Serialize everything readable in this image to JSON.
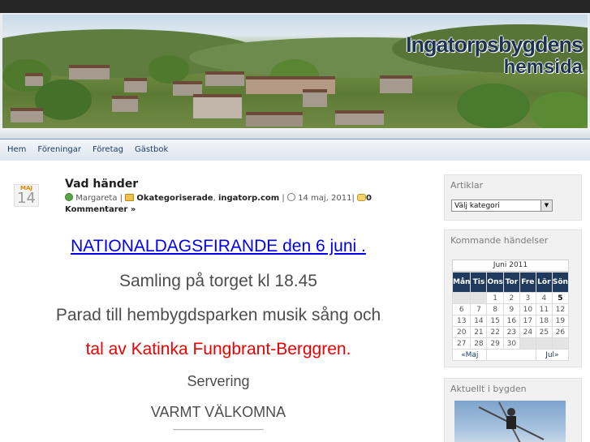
{
  "header": {
    "logo_title": "Ingatorpsbygdens",
    "logo_subtitle": "hemsida"
  },
  "nav": {
    "items": [
      "Hem",
      "Föreningar",
      "Företag",
      "Gästbok"
    ]
  },
  "post": {
    "date_month": "MAJ",
    "date_day": "14",
    "title": "Vad händer",
    "author": "Margareta",
    "category1": "Okategoriserade",
    "category2": "ingatorp.com",
    "date": "14 maj, 2011",
    "comments": "0 Kommentarer »",
    "lines": [
      "NATIONALDAGSFIRANDE den 6 juni .",
      "Samling på torget kl 18.45",
      "Parad till hembygdsparken  musik sång och",
      "tal av Katinka Fungbrant-Berggren.",
      "Servering",
      "VARMT VÄLKOMNA",
      "____________________"
    ]
  },
  "sidebar": {
    "articles_title": "Artiklar",
    "category_select": "Välj kategori",
    "events_title": "Kommande händelser",
    "calendar": {
      "month": "Juni 2011",
      "weekdays": [
        "Mån",
        "Tis",
        "Ons",
        "Tor",
        "Fre",
        "Lör",
        "Sön"
      ],
      "weeks": [
        [
          "",
          "",
          "1",
          "2",
          "3",
          "4",
          "5"
        ],
        [
          "6",
          "7",
          "8",
          "9",
          "10",
          "11",
          "12"
        ],
        [
          "13",
          "14",
          "15",
          "16",
          "17",
          "18",
          "19"
        ],
        [
          "20",
          "21",
          "22",
          "23",
          "24",
          "25",
          "26"
        ],
        [
          "27",
          "28",
          "29",
          "30",
          "",
          "",
          ""
        ]
      ],
      "prev": "«Maj",
      "next": "Jul»"
    },
    "news_title": "Aktuellt i bygden"
  }
}
